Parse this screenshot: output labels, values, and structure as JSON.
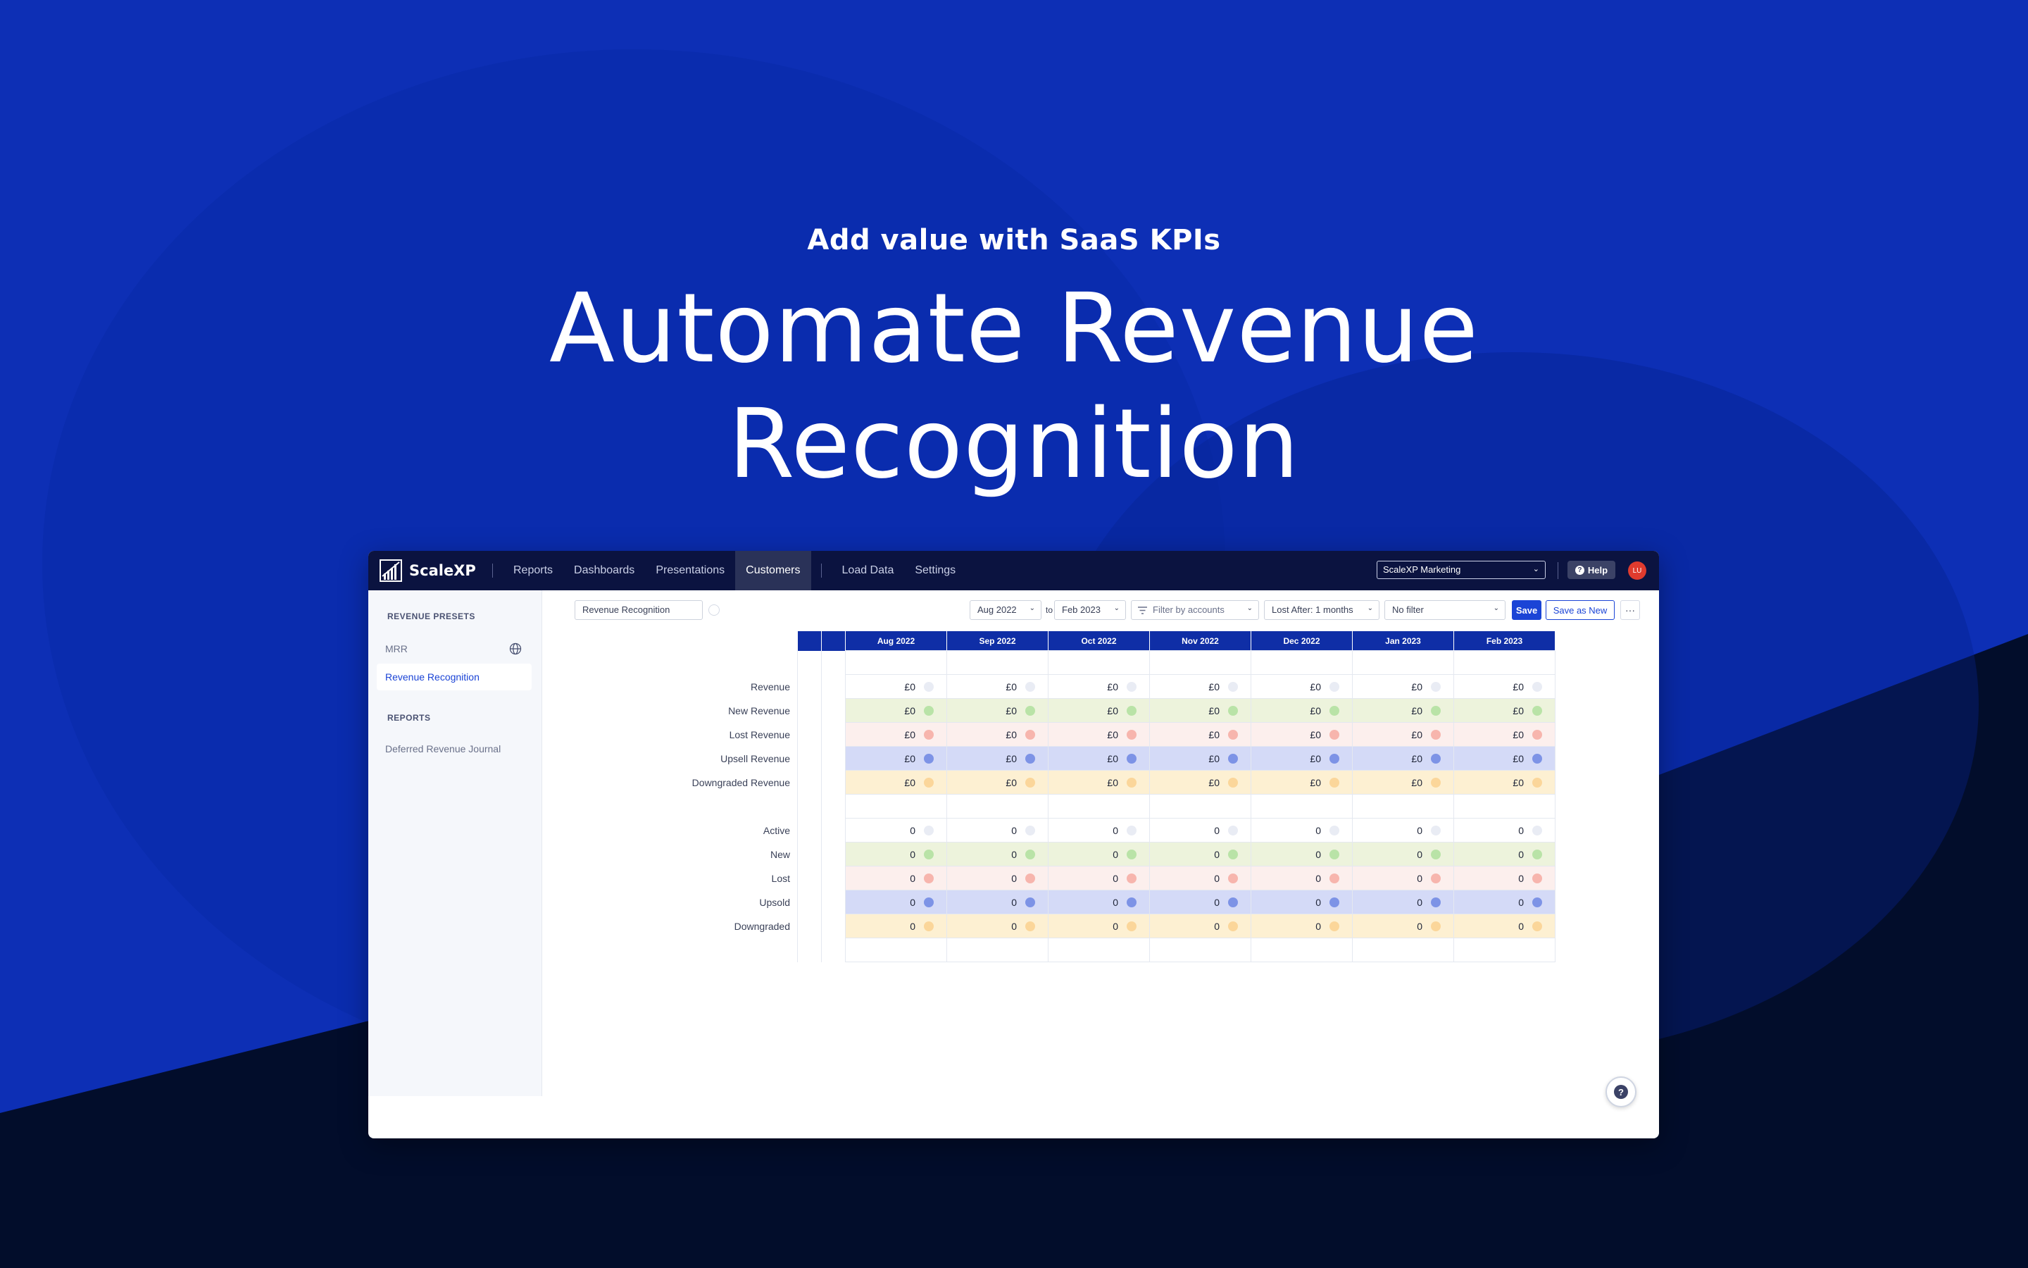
{
  "hero": {
    "subtitle": "Add value with SaaS KPIs",
    "title_line1": "Automate Revenue",
    "title_line2": "Recognition"
  },
  "colors": {
    "background_blue": "#0d2fb5",
    "background_navy": "#020d2b",
    "brand_blue": "#1b44d6",
    "header_navy": "#0b1340",
    "row_new": "#edf3dc",
    "row_lost": "#fcefed",
    "row_upsell": "#d4daf7",
    "row_downgraded": "#fdf0d2"
  },
  "app": {
    "brand": "ScaleXP",
    "nav": [
      {
        "label": "Reports"
      },
      {
        "label": "Dashboards"
      },
      {
        "label": "Presentations"
      },
      {
        "label": "Customers",
        "active": true
      },
      {
        "label": "Load Data"
      },
      {
        "label": "Settings"
      }
    ],
    "org_select": "ScaleXP Marketing",
    "help_label": "Help",
    "avatar_initials": "LU"
  },
  "sidebar": {
    "section1": "REVENUE PRESETS",
    "items1": [
      "MRR",
      "Revenue Recognition"
    ],
    "active_item": "Revenue Recognition",
    "section2": "REPORTS",
    "items2": [
      "Deferred Revenue Journal"
    ]
  },
  "toolbar": {
    "report_name": "Revenue Recognition",
    "from_month": "Aug 2022",
    "to_label": "to",
    "to_month": "Feb 2023",
    "filter_accounts": "Filter by accounts",
    "lost_after": "Lost After: 1 months",
    "no_filter": "No filter",
    "save_label": "Save",
    "save_as_new_label": "Save as New",
    "more_label": "···"
  },
  "table": {
    "months": [
      "Aug 2022",
      "Sep 2022",
      "Oct 2022",
      "Nov 2022",
      "Dec 2022",
      "Jan 2023",
      "Feb 2023"
    ],
    "revenue_rows": [
      {
        "label": "Revenue",
        "kind": "neutral",
        "values": [
          "£0",
          "£0",
          "£0",
          "£0",
          "£0",
          "£0",
          "£0"
        ]
      },
      {
        "label": "New Revenue",
        "kind": "new",
        "values": [
          "£0",
          "£0",
          "£0",
          "£0",
          "£0",
          "£0",
          "£0"
        ]
      },
      {
        "label": "Lost Revenue",
        "kind": "lost",
        "values": [
          "£0",
          "£0",
          "£0",
          "£0",
          "£0",
          "£0",
          "£0"
        ]
      },
      {
        "label": "Upsell Revenue",
        "kind": "upsell",
        "values": [
          "£0",
          "£0",
          "£0",
          "£0",
          "£0",
          "£0",
          "£0"
        ]
      },
      {
        "label": "Downgraded Revenue",
        "kind": "downgraded",
        "values": [
          "£0",
          "£0",
          "£0",
          "£0",
          "£0",
          "£0",
          "£0"
        ]
      }
    ],
    "customer_rows": [
      {
        "label": "Active",
        "kind": "neutral",
        "values": [
          "0",
          "0",
          "0",
          "0",
          "0",
          "0",
          "0"
        ]
      },
      {
        "label": "New",
        "kind": "new",
        "values": [
          "0",
          "0",
          "0",
          "0",
          "0",
          "0",
          "0"
        ]
      },
      {
        "label": "Lost",
        "kind": "lost",
        "values": [
          "0",
          "0",
          "0",
          "0",
          "0",
          "0",
          "0"
        ]
      },
      {
        "label": "Upsold",
        "kind": "upsell",
        "values": [
          "0",
          "0",
          "0",
          "0",
          "0",
          "0",
          "0"
        ]
      },
      {
        "label": "Downgraded",
        "kind": "downgraded",
        "values": [
          "0",
          "0",
          "0",
          "0",
          "0",
          "0",
          "0"
        ]
      }
    ]
  }
}
